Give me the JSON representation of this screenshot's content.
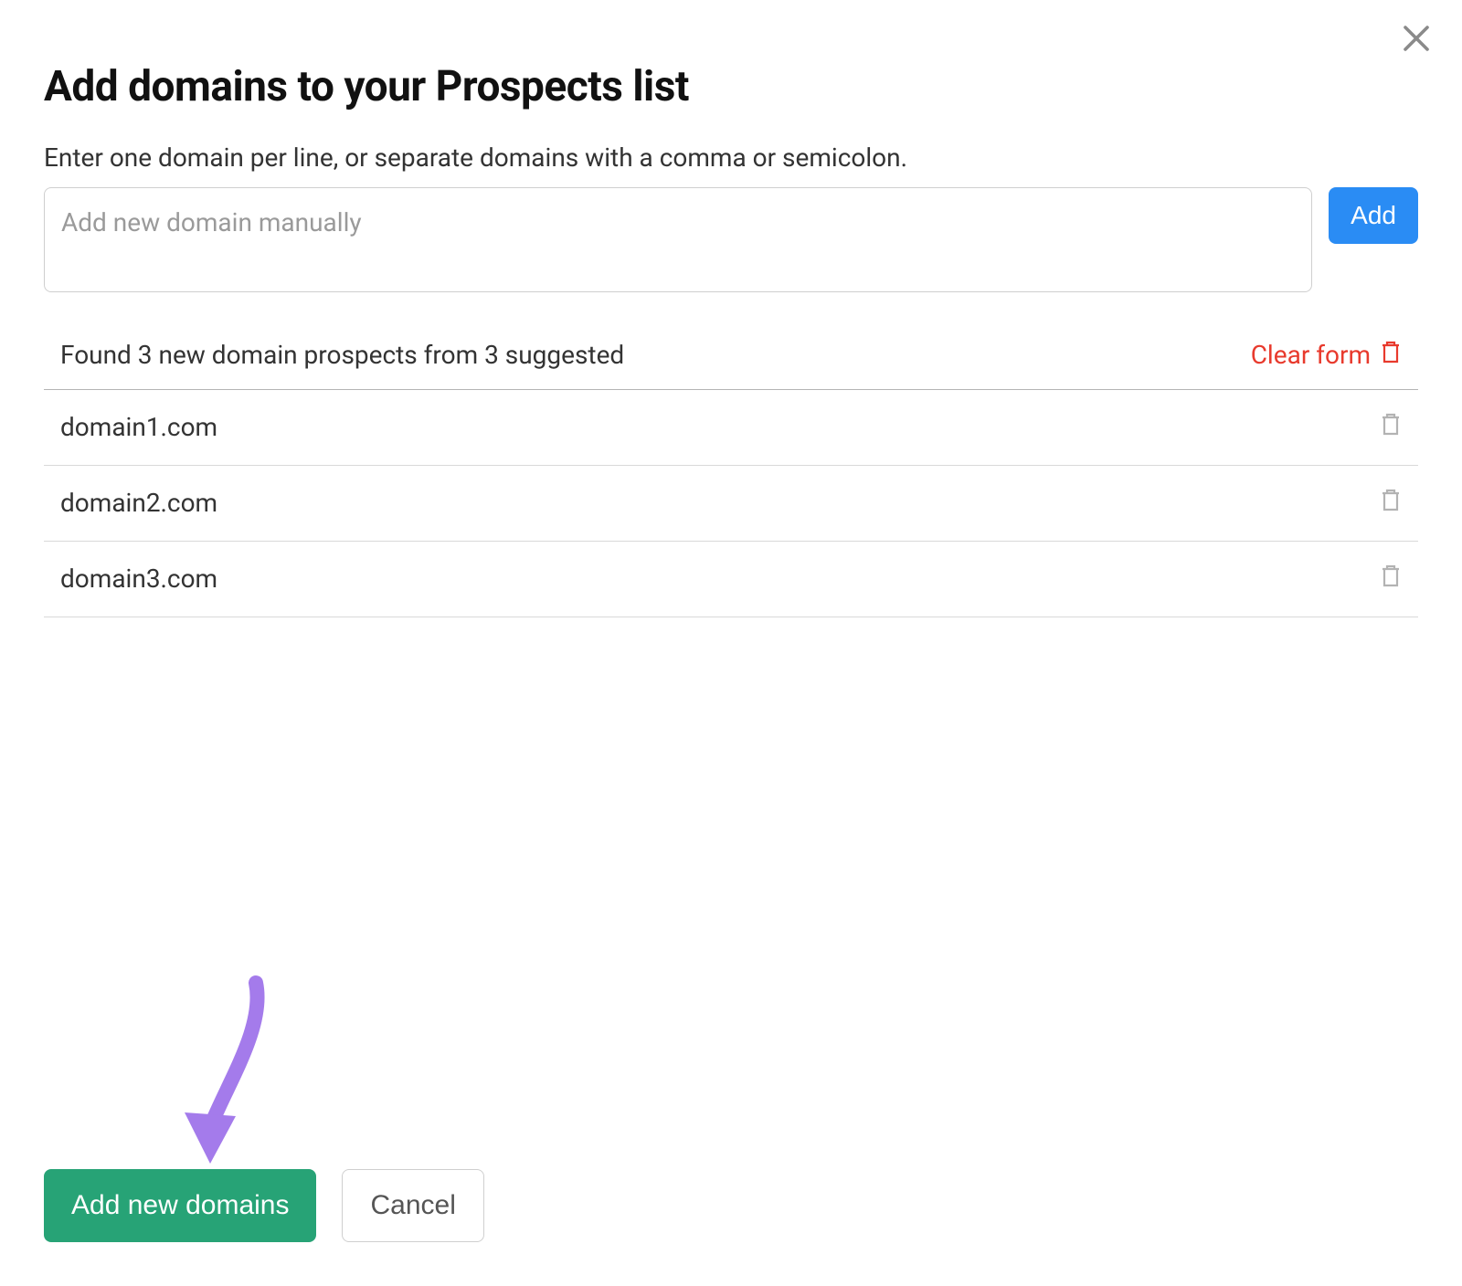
{
  "modal": {
    "title": "Add domains to your Prospects list",
    "subtitle": "Enter one domain per line, or separate domains with a comma or semicolon.",
    "input_placeholder": "Add new domain manually",
    "add_button": "Add",
    "found_text": "Found 3 new domain prospects from 3 suggested",
    "clear_form": "Clear form",
    "domains": [
      {
        "name": "domain1.com"
      },
      {
        "name": "domain2.com"
      },
      {
        "name": "domain3.com"
      }
    ],
    "primary_button": "Add new domains",
    "cancel_button": "Cancel"
  },
  "colors": {
    "primary_blue": "#2A8CF4",
    "primary_green": "#27A376",
    "danger_red": "#E83A2D",
    "annotation_purple": "#A47BEB"
  }
}
